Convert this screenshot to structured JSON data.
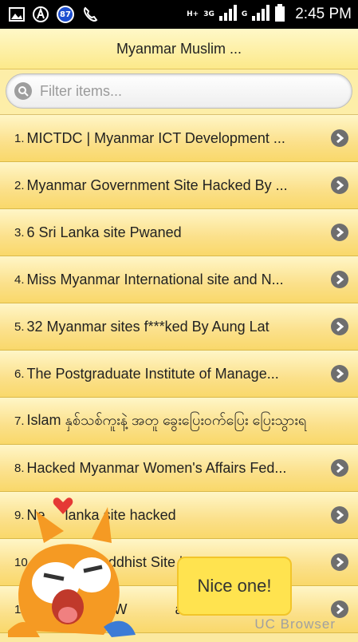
{
  "status_bar": {
    "notification_badge": "87",
    "net_h": "H+",
    "net_3g": "3G",
    "net_g": "G",
    "time": "2:45 PM"
  },
  "header": {
    "title": "Myanmar Muslim ..."
  },
  "search": {
    "placeholder": "Filter items..."
  },
  "list": {
    "items": [
      {
        "num": "1.",
        "label": "MICTDC | Myanmar ICT Development ..."
      },
      {
        "num": "2.",
        "label": "Myanmar Government Site Hacked By ..."
      },
      {
        "num": "3.",
        "label": "6 Sri Lanka site Pwaned"
      },
      {
        "num": "4.",
        "label": "Miss Myanmar International site and N..."
      },
      {
        "num": "5.",
        "label": "32 Myanmar sites f***ked By Aung Lat"
      },
      {
        "num": "6.",
        "label": "The Postgraduate Institute of Manage..."
      },
      {
        "num": "7.",
        "label": "Islam နှစ်သစ်ကူးနဲ့ အတူ ခွေးပြေးဝက်ပြေး ပြေးသွားရ"
      },
      {
        "num": "8.",
        "label": "Hacked Myanmar Women's Affairs Fed..."
      },
      {
        "num": "9.",
        "label": "Ne     lanka site hacked"
      },
      {
        "num": "10.",
        "label": "      devil Buddhist Site by MM..."
      },
      {
        "num": "11.",
        "label": "      olutions |W            an..."
      }
    ]
  },
  "overlay": {
    "bubble_text": "Nice one!",
    "brand": "UC Browser"
  },
  "colors": {
    "item_top": "#fff6c7",
    "item_bottom": "#f9d86a",
    "arrow": "#6e6e6e",
    "bubble": "#ffe34f",
    "mascot_orange": "#f59a23"
  },
  "icons": [
    "image-icon",
    "a-circle-icon",
    "notification-badge-icon",
    "phone-icon",
    "signal-icon",
    "battery-icon",
    "search-icon",
    "chevron-right-icon",
    "mascot-icon",
    "heart-icon"
  ]
}
